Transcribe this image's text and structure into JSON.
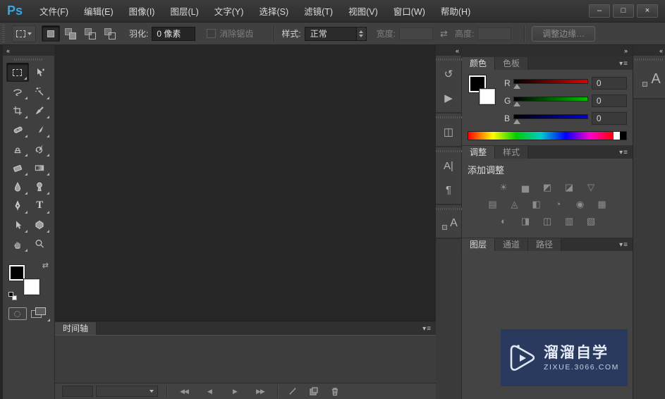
{
  "app": {
    "logo": "Ps"
  },
  "window_controls": {
    "minimize": "–",
    "maximize": "□",
    "close": "×"
  },
  "menu": {
    "items": [
      "文件(F)",
      "编辑(E)",
      "图像(I)",
      "图层(L)",
      "文字(Y)",
      "选择(S)",
      "滤镜(T)",
      "视图(V)",
      "窗口(W)",
      "帮助(H)"
    ]
  },
  "options": {
    "feather_label": "羽化:",
    "feather_value": "0 像素",
    "antialias_label": "消除锯齿",
    "style_label": "样式:",
    "style_value": "正常",
    "width_label": "宽度:",
    "width_value": "",
    "height_label": "高度:",
    "height_value": "",
    "swap_glyph": "⇄",
    "refine_edge_label": "调整边缘…"
  },
  "ui": {
    "panel_menu": "▾≡",
    "collapse_left": "«",
    "collapse_right": "»"
  },
  "toolbar": {
    "tools": [
      "rectangular-marquee",
      "move",
      "lasso",
      "magic-wand",
      "crop",
      "eyedropper",
      "spot-healing",
      "brush",
      "clone-stamp",
      "history-brush",
      "eraser",
      "gradient",
      "blur",
      "dodge",
      "pen",
      "type",
      "path-selection",
      "custom-shape",
      "hand",
      "zoom"
    ],
    "type_glyph": "T",
    "selected_tool": "rectangular-marquee",
    "foreground_color": "#000000",
    "background_color": "#ffffff"
  },
  "mid_dock": {
    "history_glyph": "↺",
    "actions_glyph": "▶",
    "properties_glyph": "◫",
    "character_glyph": "A|",
    "paragraph_glyph": "¶",
    "char_styles_glyph": "A"
  },
  "far_dock": {
    "char_styles_glyph": "A"
  },
  "panels": {
    "color": {
      "tabs": [
        "颜色",
        "色板"
      ],
      "active_tab": "颜色",
      "channels": [
        {
          "label": "R",
          "value": "0"
        },
        {
          "label": "G",
          "value": "0"
        },
        {
          "label": "B",
          "value": "0"
        }
      ]
    },
    "adjustments": {
      "tabs": [
        "调整",
        "样式"
      ],
      "active_tab": "调整",
      "title": "添加调整",
      "row1": [
        {
          "name": "brightness-contrast",
          "glyph": "☀"
        },
        {
          "name": "levels",
          "glyph": "▅"
        },
        {
          "name": "curves",
          "glyph": "◩"
        },
        {
          "name": "exposure",
          "glyph": "◪"
        },
        {
          "name": "vibrance",
          "glyph": "▽"
        }
      ],
      "row2": [
        {
          "name": "hue-saturation",
          "glyph": "▤"
        },
        {
          "name": "color-balance",
          "glyph": "◬"
        },
        {
          "name": "black-white",
          "glyph": "◧"
        },
        {
          "name": "photo-filter",
          "glyph": "◔"
        },
        {
          "name": "channel-mixer",
          "glyph": "◉"
        },
        {
          "name": "color-lookup",
          "glyph": "▦"
        }
      ],
      "row3": [
        {
          "name": "invert",
          "glyph": "◐"
        },
        {
          "name": "posterize",
          "glyph": "◨"
        },
        {
          "name": "threshold",
          "glyph": "◫"
        },
        {
          "name": "gradient-map",
          "glyph": "▥"
        },
        {
          "name": "selective-color",
          "glyph": "▧"
        }
      ]
    },
    "layers": {
      "tabs": [
        "图层",
        "通道",
        "路径"
      ],
      "active_tab": "图层"
    },
    "timeline": {
      "tab": "时间轴",
      "controls": {
        "first": "◀◀",
        "prev": "◀",
        "play": "▶",
        "next": "▶▶"
      }
    }
  },
  "watermark": {
    "title": "溜溜自学",
    "url": "zixue.3066.com",
    "bg_color": "#293a5e"
  },
  "colors": {
    "logo_blue": "#38a6e2",
    "canvas": "#262626",
    "panel": "#444444",
    "chrome": "#3a3a3a"
  }
}
